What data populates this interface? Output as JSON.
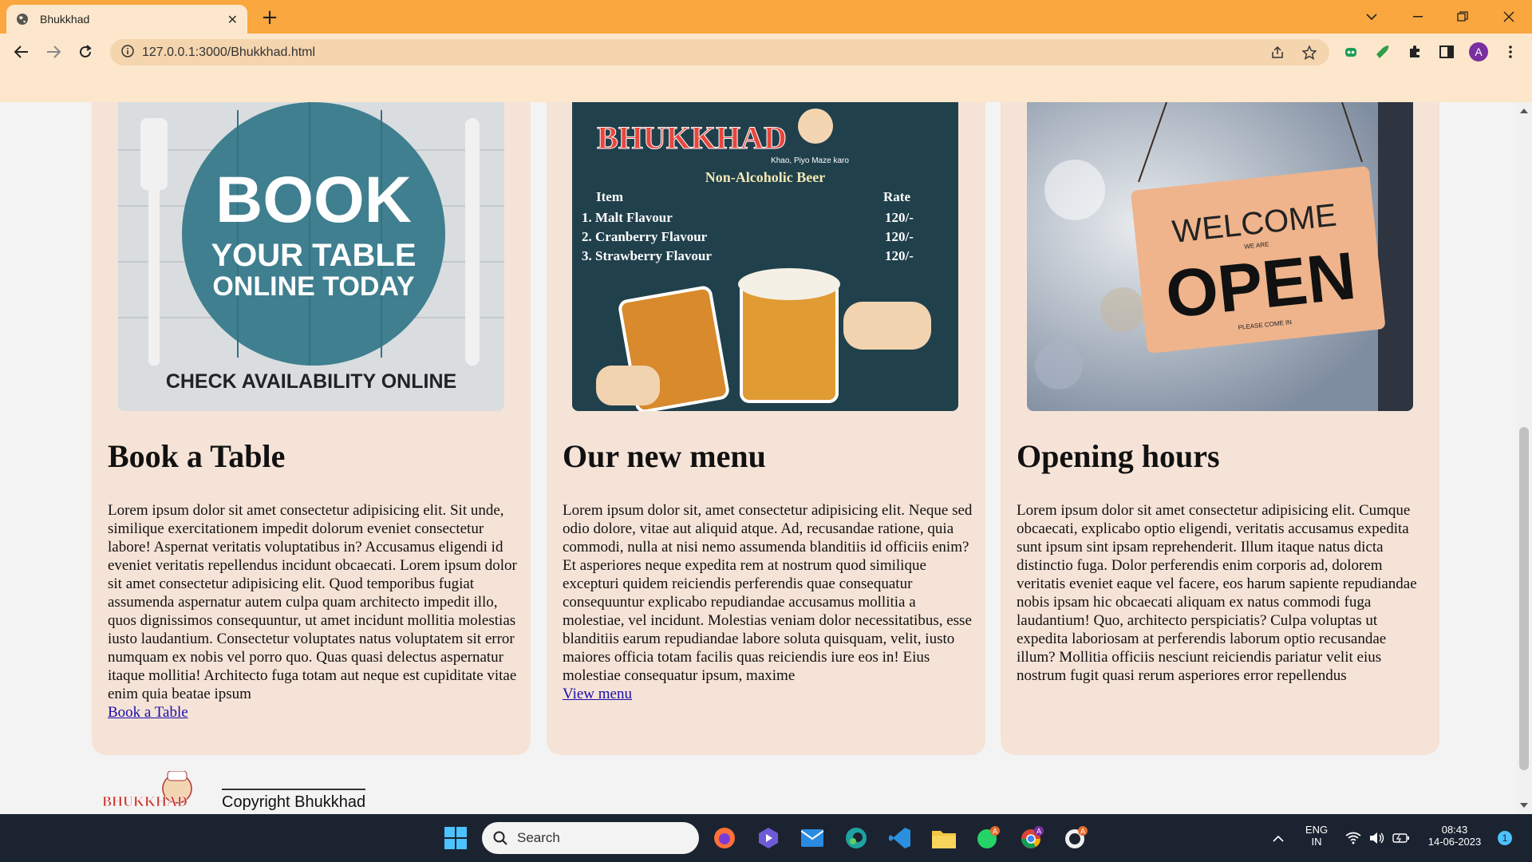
{
  "browser": {
    "tab_title": "Bhukkhad",
    "url": "127.0.0.1:3000/Bhukkhad.html",
    "avatar_letter": "A",
    "accent": "#f9a73e"
  },
  "cards": [
    {
      "image_lines": [
        "BOOK",
        "YOUR TABLE",
        "ONLINE TODAY",
        "CHECK AVAILABILITY ONLINE"
      ],
      "title": "Book a Table",
      "body": "Lorem ipsum dolor sit amet consectetur adipisicing elit. Sit unde, similique exercitationem impedit dolorum eveniet consectetur labore! Aspernat veritatis voluptatibus in? Accusamus eligendi id eveniet veritatis repellendus incidunt obcaecati. Lorem ipsum dolor sit amet consectetur adipisicing elit. Quod temporibus fugiat assumenda aspernatur autem culpa quam architecto impedit illo, quos dignissimos consequuntur, ut amet incidunt mollitia molestias iusto laudantium. Consectetur voluptates natus voluptatem sit error numquam ex nobis vel porro quo. Quas quasi delectus aspernatur itaque mollitia! Architecto fuga totam aut neque est cupiditate vitae enim quia beatae ipsum",
      "link": "Book a Table"
    },
    {
      "image_lines": [
        "BHUKKHAD",
        "Khao, Piyo Maze karo",
        "Non-Alcoholic Beer",
        "Item",
        "Rate",
        "1. Malt Flavour",
        "120/-",
        "2. Cranberry Flavour",
        "120/-",
        "3. Strawberry Flavour",
        "120/-"
      ],
      "title": "Our new menu",
      "body": "Lorem ipsum dolor sit, amet consectetur adipisicing elit. Neque sed odio dolore, vitae aut aliquid atque. Ad, recusandae ratione, quia commodi, nulla at nisi nemo assumenda blanditiis id officiis enim? Et asperiores neque expedita rem at nostrum quod similique excepturi quidem reiciendis perferendis quae consequatur consequuntur explicabo repudiandae accusamus mollitia a molestiae, vel incidunt. Molestias veniam dolor necessitatibus, esse blanditiis earum repudiandae labore soluta quisquam, velit, iusto maiores officia totam facilis quas reiciendis iure eos in! Eius molestiae consequatur ipsum, maxime",
      "link": "View menu"
    },
    {
      "image_lines": [
        "WELCOME",
        "WE ARE",
        "OPEN",
        "PLEASE COME IN"
      ],
      "title": "Opening hours",
      "body": "Lorem ipsum dolor sit amet consectetur adipisicing elit. Cumque obcaecati, explicabo optio eligendi, veritatis accusamus expedita sunt ipsum sint ipsam reprehenderit. Illum itaque natus dicta distinctio fuga. Dolor perferendis enim corporis ad, dolorem veritatis eveniet eaque vel facere, eos harum sapiente repudiandae nobis ipsam hic obcaecati aliquam ex natus commodi fuga laudantium! Quo, architecto perspiciatis? Culpa voluptas ut expedita laboriosam at perferendis laborum optio recusandae illum? Mollitia officiis nesciunt reiciendis pariatur velit eius nostrum fugit quasi rerum asperiores error repellendus"
    }
  ],
  "footer": {
    "logo_text": "BHUKKHAD",
    "copyright": "Copyright Bhukkhad"
  },
  "taskbar": {
    "search_placeholder": "Search",
    "lang_top": "ENG",
    "lang_bottom": "IN",
    "time": "08:43",
    "date": "14-06-2023",
    "notification_count": "1",
    "badge_letter": "A"
  }
}
